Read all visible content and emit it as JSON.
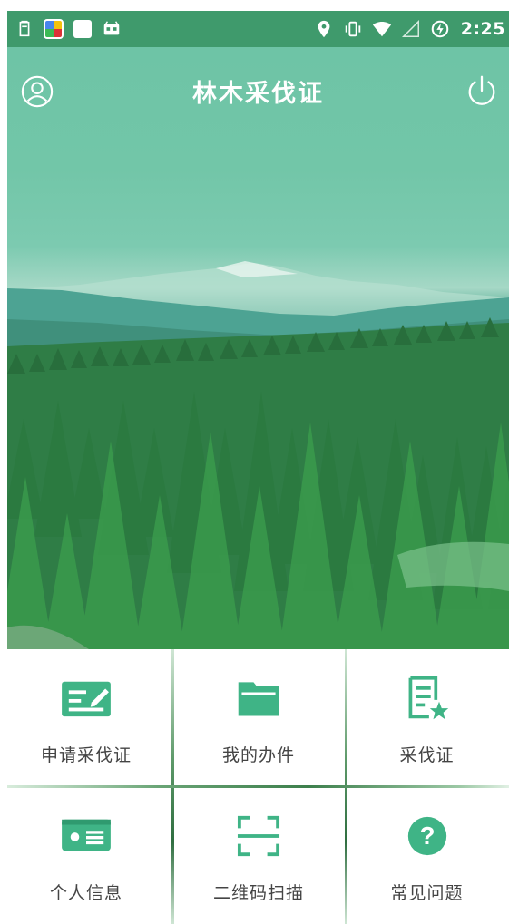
{
  "status_bar": {
    "time": "2:25",
    "left_icons": [
      "clipboard-icon",
      "colorful-app-icon",
      "white-app-icon",
      "android-cat-icon"
    ],
    "right_icons": [
      "location-icon",
      "vibrate-icon",
      "wifi-icon",
      "signal-icon",
      "battery-charging-icon"
    ]
  },
  "header": {
    "title": "林木采伐证"
  },
  "colors": {
    "accent": "#3fb486",
    "status_bar": "#3f9a6c",
    "label_text": "#444444"
  },
  "menu": [
    {
      "label": "申请采伐证",
      "icon": "apply-certificate-icon"
    },
    {
      "label": "我的办件",
      "icon": "folder-icon"
    },
    {
      "label": "采伐证",
      "icon": "certificate-star-icon"
    },
    {
      "label": "个人信息",
      "icon": "id-card-icon"
    },
    {
      "label": "二维码扫描",
      "icon": "qr-scan-icon"
    },
    {
      "label": "常见问题",
      "icon": "help-question-icon"
    }
  ]
}
